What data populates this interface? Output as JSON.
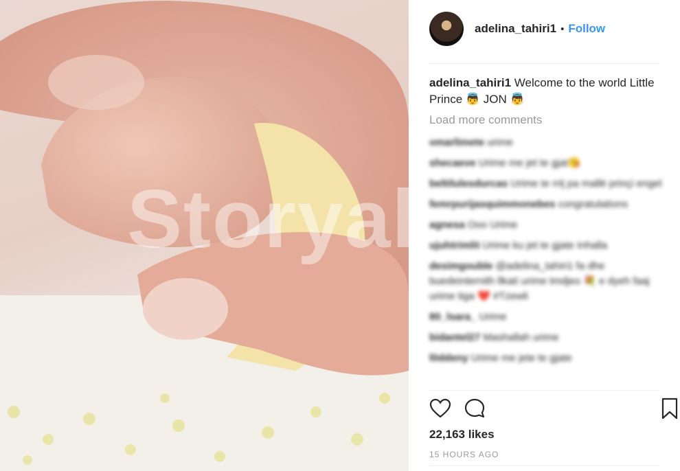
{
  "post": {
    "username": "adelina_tahiri1",
    "separator": "•",
    "follow_label": "Follow",
    "caption_username": "adelina_tahiri1",
    "caption_text": "Welcome to the world Little Prince 👼 JON 👼",
    "load_more": "Load more comments",
    "likes": "22,163 likes",
    "time": "15 HOURS AGO",
    "watermark": "Storyal"
  },
  "comments": [
    {
      "user": "omarlimete",
      "text": "urime"
    },
    {
      "user": "shecaeve",
      "text": "Urime me jet te gjat😘"
    },
    {
      "user": "beltilulesdurcas",
      "text": "Urime te rriţ pa mallë prinçi engel"
    },
    {
      "user": "femrpurijasquimmonebes",
      "text": "congratulations"
    },
    {
      "user": "agnesa",
      "text": "Ooo Urime"
    },
    {
      "user": "ujuhtrimlit",
      "text": "Urime ku jet te gjate Inhalla"
    },
    {
      "user": "desimgouble",
      "text": "@adelina_tahiri1 fa dhe buedeinternith llkati urime tmdjeo 💐 e dyeh faaj urime tiga ❤️ #Tzewli"
    },
    {
      "user": "80_lsara_",
      "text": "Urime"
    },
    {
      "user": "bidantel27",
      "text": "Mashallah urime"
    },
    {
      "user": "l0ddeny",
      "text": "Urime me jete te gjate"
    }
  ],
  "icons": {
    "like": "heart-icon",
    "comment": "comment-icon",
    "save": "bookmark-icon"
  },
  "colors": {
    "link": "#3897f0",
    "muted": "#999999",
    "text": "#262626"
  }
}
